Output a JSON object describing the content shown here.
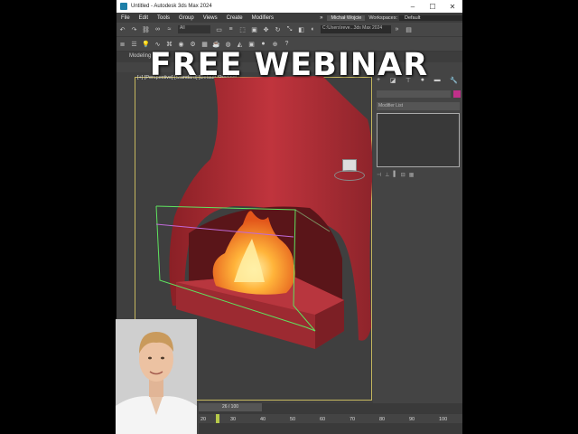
{
  "window": {
    "title": "Untitled - Autodesk 3ds Max 2024",
    "minimize": "–",
    "maximize": "☐",
    "close": "✕"
  },
  "menu": {
    "items": [
      "File",
      "Edit",
      "Tools",
      "Group",
      "Views",
      "Create",
      "Modifiers"
    ],
    "overflow": "»",
    "user": "Michał Wojcie",
    "workspaces_label": "Workspaces:",
    "workspace": "Default"
  },
  "toolbar": {
    "selection_filter": "All",
    "project_path": "C:\\Users\\reve...3ds Max 2024"
  },
  "ribbon": {
    "tab_label": "Modeling"
  },
  "viewport": {
    "label": "[+] [Perspective] [Standard] [Default Shading]"
  },
  "command_panel": {
    "modifier_list": "Modifier List"
  },
  "timeline": {
    "frame_display": "26 / 100",
    "ticks": [
      "20",
      "30",
      "40",
      "50",
      "60",
      "70",
      "80",
      "90",
      "100"
    ],
    "current_frame_fraction": 0.26
  },
  "overlay": {
    "headline": "FREE WEBINAR"
  },
  "colors": {
    "fireplace": "#b0323a",
    "flame": "#ff9a1e",
    "gizmo_green": "#5fe35f",
    "viewport_border": "#c5b75f",
    "object_color_swatch": "#c0308a"
  }
}
